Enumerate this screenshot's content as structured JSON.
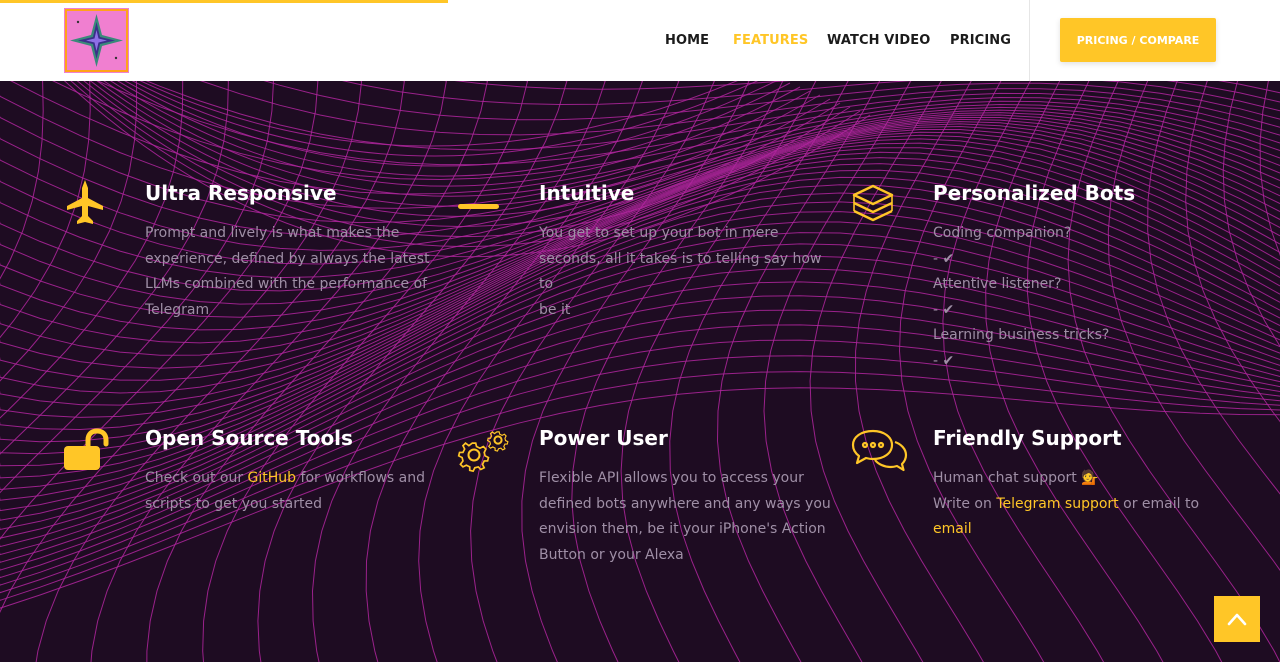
{
  "header": {
    "nav": [
      {
        "label": "HOME",
        "active": false
      },
      {
        "label": "FEATURES",
        "active": true
      },
      {
        "label": "WATCH VIDEO",
        "active": false
      },
      {
        "label": "PRICING",
        "active": false
      }
    ],
    "cta_label": "PRICING / COMPARE",
    "scroll_progress_percent": 35
  },
  "colors": {
    "accent": "#ffc627",
    "background": "#1e0c22",
    "pattern": "#b0269e",
    "body_text": "#9f8fa6"
  },
  "features": [
    {
      "icon": "jet-icon",
      "title": "Ultra Responsive",
      "lines": [
        "Prompt and lively is what makes the",
        "experience, defined by always the latest",
        "LLMs combined with the performance of",
        "Telegram"
      ]
    },
    {
      "icon": "dash-icon",
      "title": "Intuitive",
      "lines": [
        "You get to set up your bot in mere",
        "seconds, all it takes is to telling say how to",
        "be it"
      ]
    },
    {
      "icon": "layers-icon",
      "title": "Personalized Bots",
      "lines": [
        "Coding companion?",
        "- ✔",
        "Attentive listener?",
        "- ✔",
        "Learning business tricks?",
        "- ✔"
      ]
    },
    {
      "icon": "unlock-icon",
      "title": "Open Source Tools",
      "line1_before": "Check out our ",
      "line1_link": "GitHub",
      "line1_after": " for workflows and",
      "line2": "scripts to get you started"
    },
    {
      "icon": "gears-icon",
      "title": "Power User",
      "lines": [
        "Flexible API allows you to access your",
        "defined bots anywhere and any ways you",
        "envision them, be it your iPhone's Action",
        "Button or your Alexa"
      ]
    },
    {
      "icon": "chat-bubbles-icon",
      "title": "Friendly Support",
      "line1": "Human chat support 💁",
      "line2_before": "Write on ",
      "line2_link": "Telegram support",
      "line2_after": " or email to",
      "line3_link": "email"
    }
  ],
  "back_to_top_icon": "chevron-up-icon"
}
